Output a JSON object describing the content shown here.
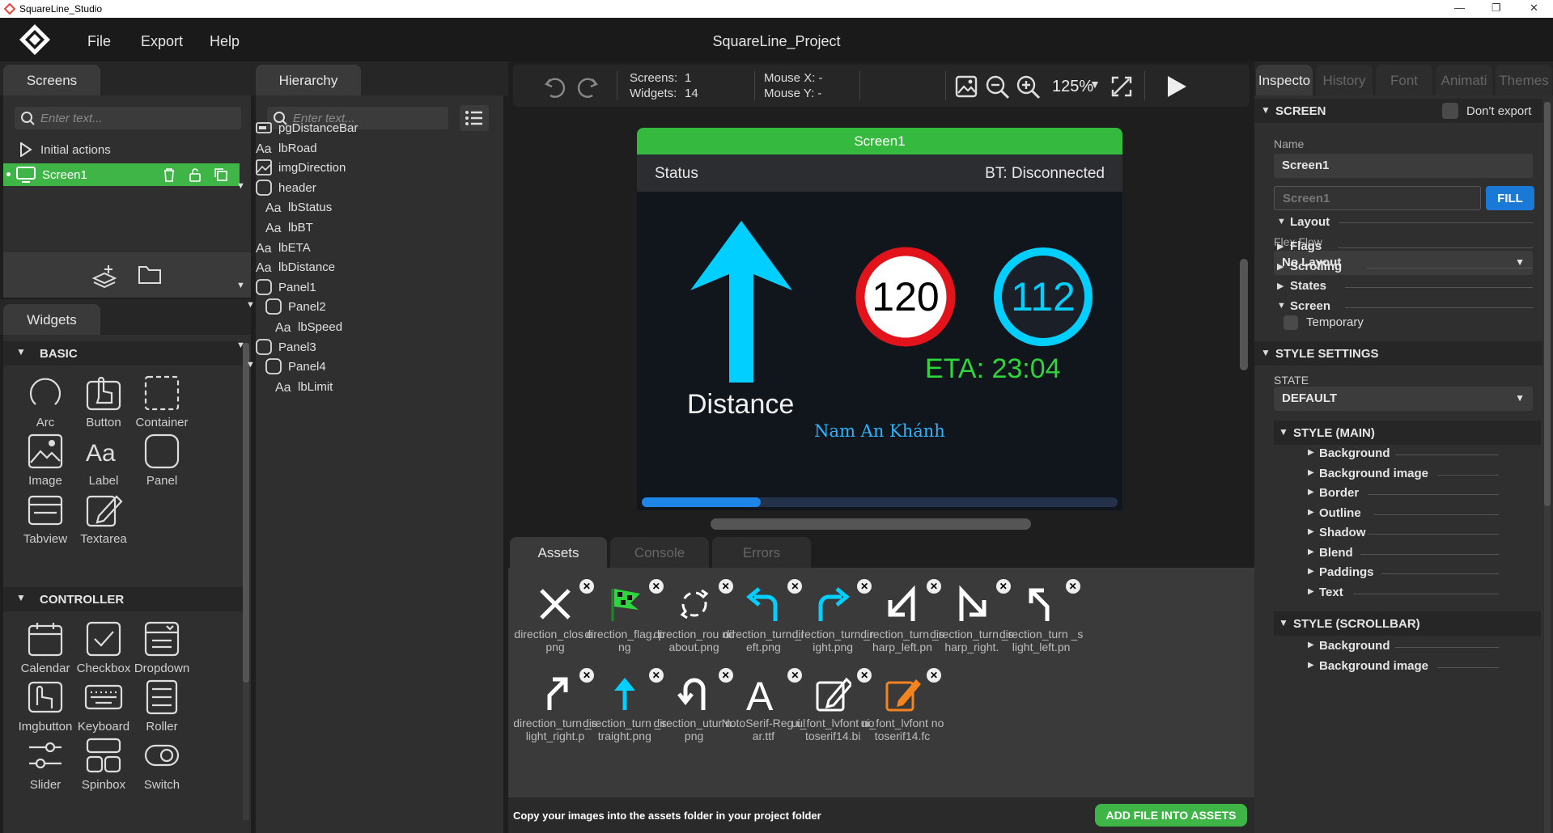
{
  "window": {
    "title": "SquareLine_Studio",
    "project": "SquareLine_Project"
  },
  "menu": [
    "File",
    "Export",
    "Help"
  ],
  "screens_panel": {
    "tab": "Screens",
    "search_placeholder": "Enter text...",
    "items": [
      {
        "label": "Initial actions"
      },
      {
        "label": "Screen1"
      }
    ]
  },
  "hierarchy": {
    "tab": "Hierarchy",
    "search_placeholder": "Enter text...",
    "items": [
      {
        "label": "pgDistanceBar",
        "icon": "bar-icon",
        "indent": 0,
        "arrow": false
      },
      {
        "label": "lbRoad",
        "icon": "label-icon",
        "indent": 0,
        "arrow": false
      },
      {
        "label": "imgDirection",
        "icon": "image-icon",
        "indent": 0,
        "arrow": false
      },
      {
        "label": "header",
        "icon": "panel-icon",
        "indent": 0,
        "arrow": true
      },
      {
        "label": "lbStatus",
        "icon": "label-icon",
        "indent": 1,
        "arrow": false
      },
      {
        "label": "lbBT",
        "icon": "label-icon",
        "indent": 1,
        "arrow": false
      },
      {
        "label": "lbETA",
        "icon": "label-icon",
        "indent": 0,
        "arrow": false
      },
      {
        "label": "lbDistance",
        "icon": "label-icon",
        "indent": 0,
        "arrow": false
      },
      {
        "label": "Panel1",
        "icon": "panel-icon",
        "indent": 0,
        "arrow": true
      },
      {
        "label": "Panel2",
        "icon": "panel-icon",
        "indent": 1,
        "arrow": true
      },
      {
        "label": "lbSpeed",
        "icon": "label-icon",
        "indent": 2,
        "arrow": false
      },
      {
        "label": "Panel3",
        "icon": "panel-icon",
        "indent": 0,
        "arrow": true
      },
      {
        "label": "Panel4",
        "icon": "panel-icon",
        "indent": 1,
        "arrow": true
      },
      {
        "label": "lbLimit",
        "icon": "label-icon",
        "indent": 2,
        "arrow": false
      }
    ]
  },
  "widgets": {
    "tab": "Widgets",
    "basic_title": "BASIC",
    "controller_title": "CONTROLLER",
    "basic": [
      "Arc",
      "Button",
      "Container",
      "Image",
      "Label",
      "Panel",
      "Tabview",
      "Textarea"
    ],
    "controller": [
      "Calendar",
      "Checkbox",
      "Dropdown",
      "Imgbutton",
      "Keyboard",
      "Roller",
      "Slider",
      "Spinbox",
      "Switch"
    ]
  },
  "toolbar": {
    "screens_label": "Screens:",
    "screens_value": "1",
    "widgets_label": "Widgets:",
    "widgets_value": "14",
    "mouse_x": "Mouse X: -",
    "mouse_y": "Mouse Y: -",
    "zoom": "125%"
  },
  "canvas": {
    "screen_name": "Screen1",
    "status": "Status",
    "bt": "BT: Disconnected",
    "limit": "120",
    "speed": "112",
    "eta": "ETA: 23:04",
    "distance": "Distance",
    "road": "Nam An Khánh",
    "progress": 0.25,
    "colors": {
      "green": "#36b93f",
      "cyan": "#00cfff",
      "red": "#e3131b",
      "eta": "#2fd53c",
      "road": "#29b6ff"
    }
  },
  "bottom": {
    "tabs": [
      "Assets",
      "Console",
      "Errors"
    ],
    "hint": "Copy your images into the assets folder in your project folder",
    "add_button": "ADD FILE INTO ASSETS",
    "assets": [
      {
        "name": "direction_clos e.png",
        "icon": "close-arrow-icon"
      },
      {
        "name": "direction_flag. png",
        "icon": "flag-icon"
      },
      {
        "name": "direction_rou ndabout.png",
        "icon": "roundabout-icon"
      },
      {
        "name": "direction_turn _left.png",
        "icon": "turn-left-icon"
      },
      {
        "name": "direction_turn _right.png",
        "icon": "turn-right-icon"
      },
      {
        "name": "direction_turn _sharp_left.pn",
        "icon": "sharp-left-icon"
      },
      {
        "name": "direction_turn _sharp_right.",
        "icon": "sharp-right-icon"
      },
      {
        "name": "direction_turn _slight_left.pn",
        "icon": "slight-left-icon"
      },
      {
        "name": "direction_turn _slight_right.p",
        "icon": "slight-right-icon"
      },
      {
        "name": "direction_turn _straight.png",
        "icon": "straight-icon"
      },
      {
        "name": "direction_utur n.png",
        "icon": "uturn-icon"
      },
      {
        "name": "NotoSerif-Reg ular.ttf",
        "icon": "font-icon"
      },
      {
        "name": "ui_font_lvfont notoserif14.bi",
        "icon": "edit-icon"
      },
      {
        "name": "ui_font_lvfont notoserif14.fc",
        "icon": "edit-orange-icon"
      }
    ]
  },
  "inspector": {
    "tabs": [
      "Inspecto",
      "History",
      "Font",
      "Animati",
      "Themes"
    ],
    "screen_title": "SCREEN",
    "dont_export": "Don't export",
    "name_label": "Name",
    "name_value": "Screen1",
    "name_placeholder": "Screen1",
    "fill": "FILL",
    "layout": "Layout",
    "flex_flow": "Flex Flow",
    "no_layout": "No Layout",
    "sections": [
      "Flags",
      "Scrolling",
      "States",
      "Screen"
    ],
    "temporary": "Temporary",
    "style_settings": "STYLE SETTINGS",
    "state_label": "STATE",
    "state_value": "DEFAULT",
    "style_main": "STYLE (MAIN)",
    "main_items": [
      "Background",
      "Background image",
      "Border",
      "Outline",
      "Shadow",
      "Blend",
      "Paddings",
      "Text"
    ],
    "style_scroll": "STYLE (SCROLLBAR)",
    "scroll_items": [
      "Background",
      "Background image"
    ]
  }
}
